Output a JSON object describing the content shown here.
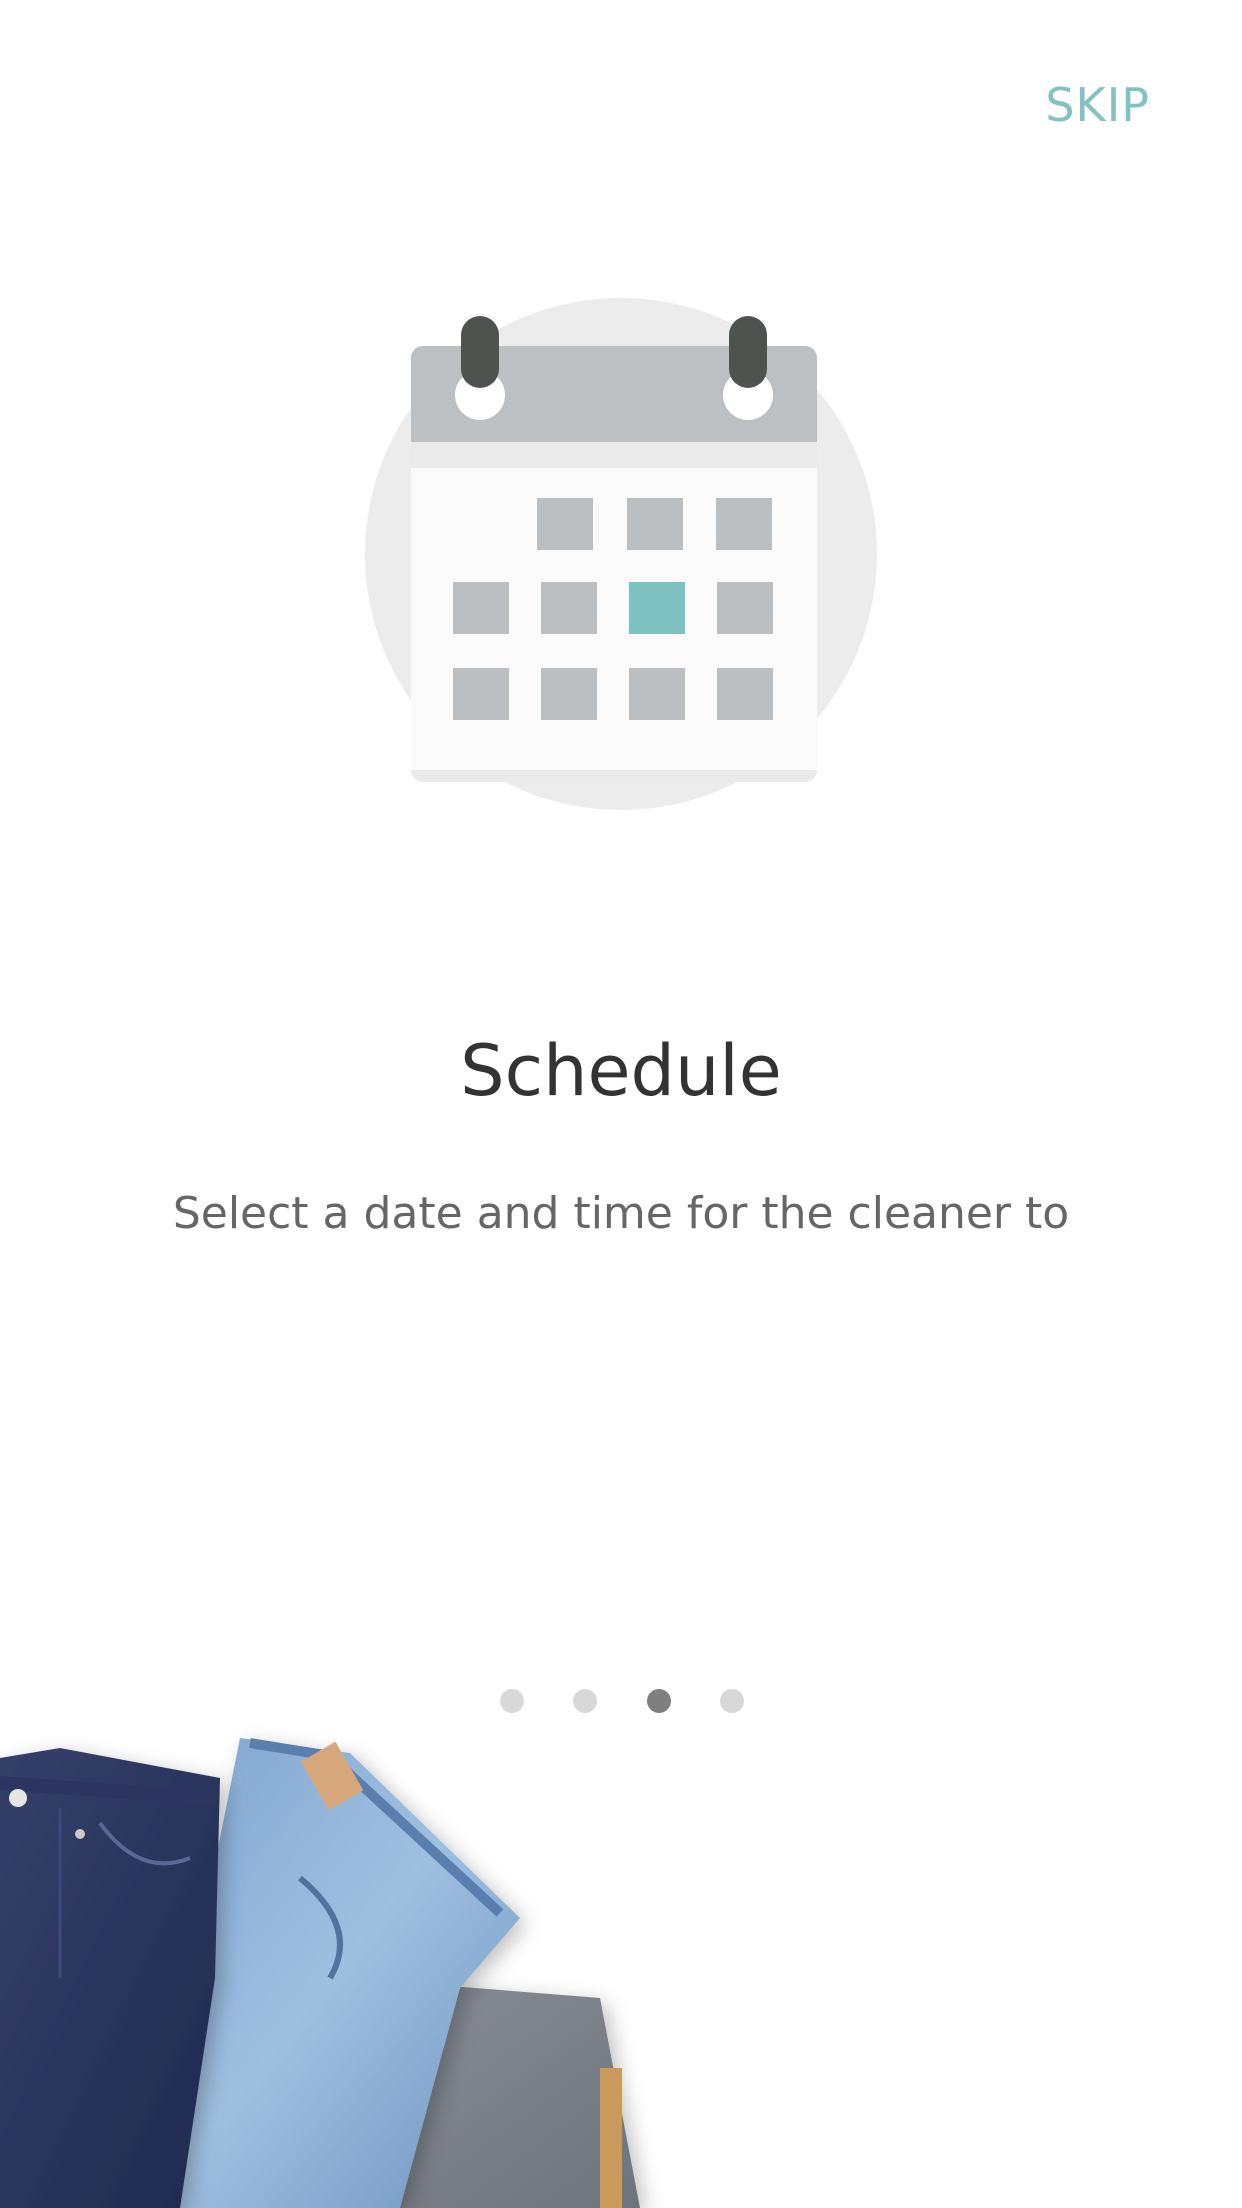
{
  "header": {
    "skip_label": "SKIP"
  },
  "onboarding": {
    "title": "Schedule",
    "description": "Select a date and time for the cleaner to",
    "illustration_icon": "calendar-icon",
    "page_count": 4,
    "current_page": 3
  },
  "colors": {
    "accent": "#82c2c3",
    "highlight_day": "#7dc1c0",
    "dot_inactive": "#d8d8d8",
    "dot_active": "#7f7f7f"
  },
  "decoration": {
    "image": "folded-jeans-image"
  }
}
